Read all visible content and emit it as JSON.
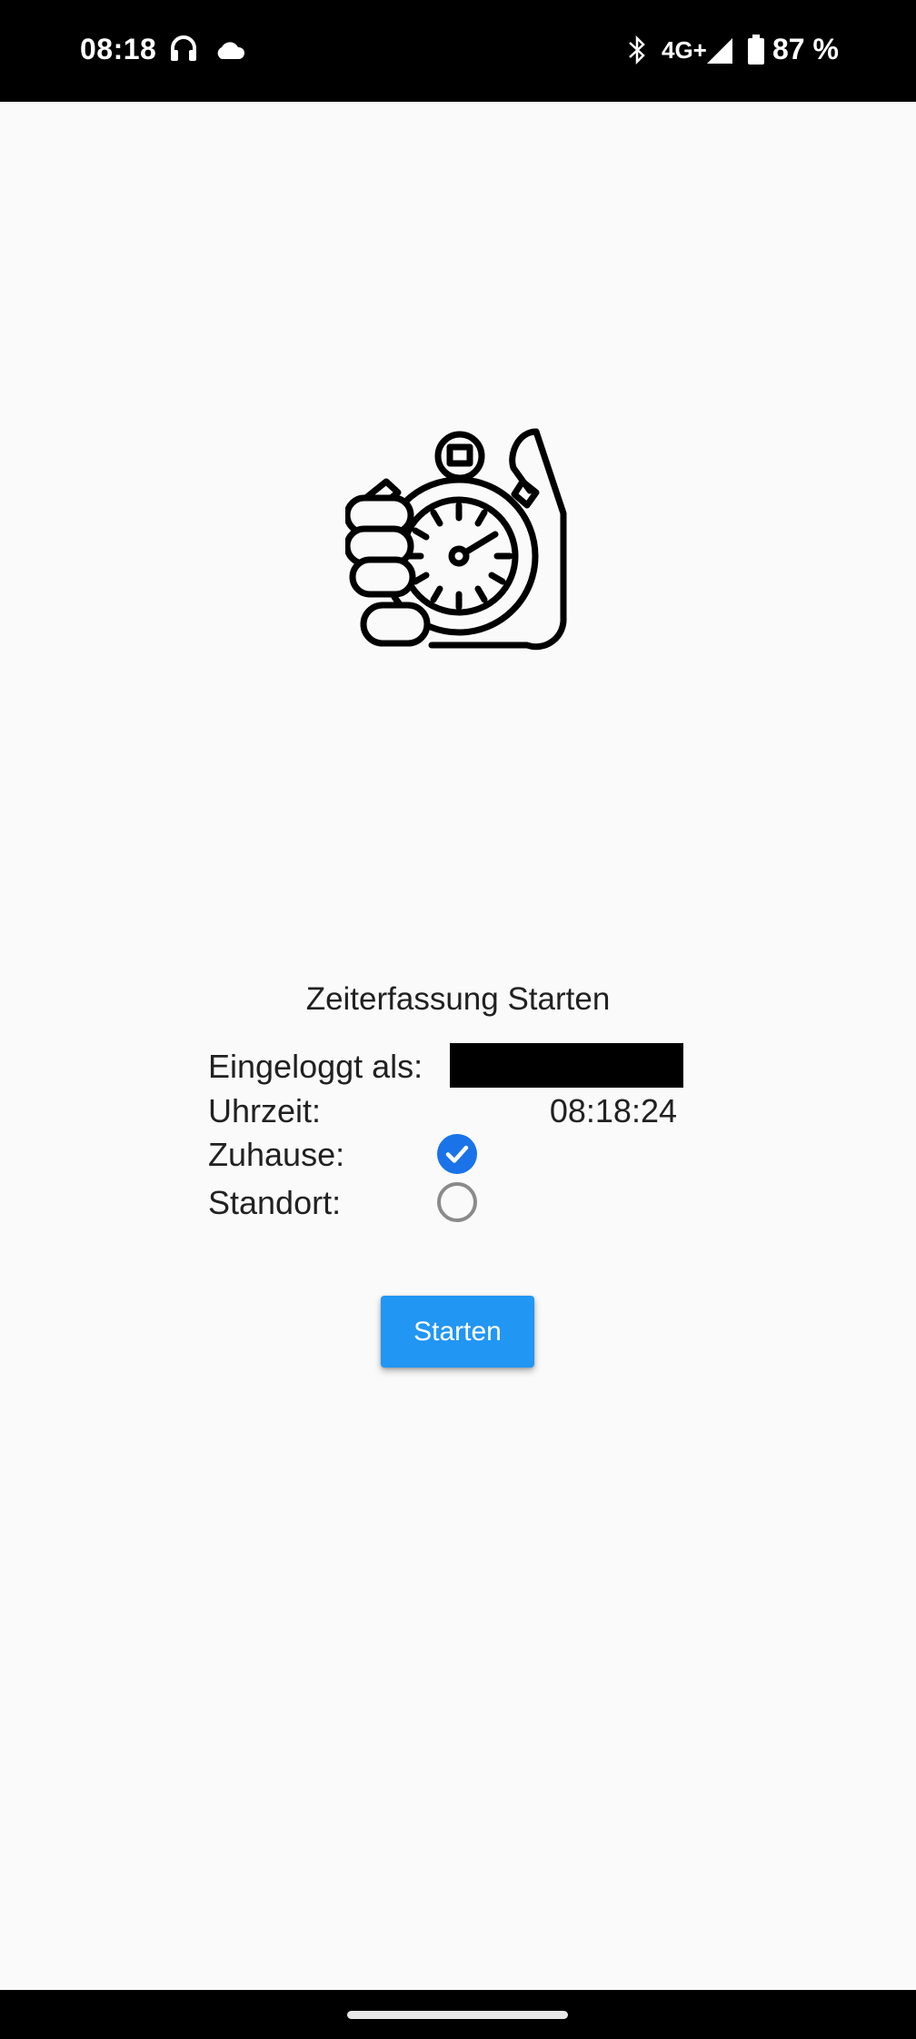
{
  "status_bar": {
    "time": "08:18",
    "network": "4G+",
    "battery": "87 %",
    "icons": [
      "headphones-icon",
      "cloud-icon",
      "bluetooth-icon",
      "signal-icon",
      "battery-icon"
    ]
  },
  "screen": {
    "title": "Zeiterfassung Starten",
    "logo_icon": "stopwatch-in-hand-icon",
    "fields": {
      "user_label": "Eingeloggt als:",
      "time_label": "Uhrzeit:",
      "time_value": "08:18:24",
      "home_label": "Zuhause:",
      "location_label": "Standort:"
    },
    "options": {
      "home_selected": true,
      "location_selected": false
    },
    "start_button": "Starten"
  },
  "colors": {
    "accent": "#2196f3",
    "radio_selected": "#1a73e8",
    "background": "#fafafa"
  }
}
